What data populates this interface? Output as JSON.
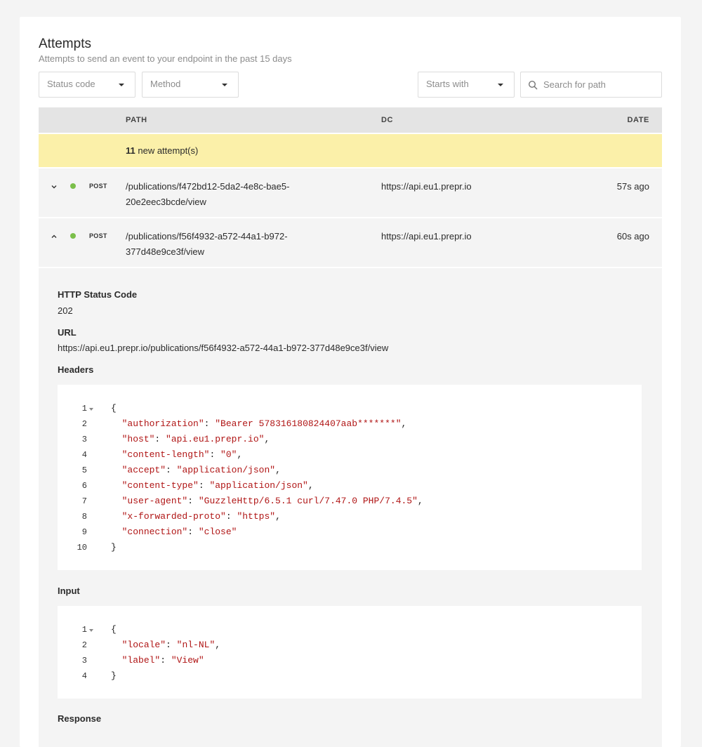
{
  "header": {
    "title": "Attempts",
    "subtitle": "Attempts to send an event to your endpoint in the past 15 days"
  },
  "filters": {
    "status_code": "Status code",
    "method": "Method",
    "match_mode": "Starts with",
    "search_placeholder": "Search for path"
  },
  "table": {
    "columns": {
      "path": "PATH",
      "dc": "DC",
      "date": "DATE"
    },
    "banner": {
      "count": "11",
      "text": " new attempt(s)"
    },
    "rows": [
      {
        "method": "POST",
        "path": "/publications/f472bd12-5da2-4e8c-bae5-20e2eec3bcde/view",
        "dc": "https://api.eu1.prepr.io",
        "date": "57s ago",
        "expanded": false
      },
      {
        "method": "POST",
        "path": "/publications/f56f4932-a572-44a1-b972-377d48e9ce3f/view",
        "dc": "https://api.eu1.prepr.io",
        "date": "60s ago",
        "expanded": true
      }
    ]
  },
  "detail": {
    "status_label": "HTTP Status Code",
    "status_value": "202",
    "url_label": "URL",
    "url_value": "https://api.eu1.prepr.io/publications/f56f4932-a572-44a1-b972-377d48e9ce3f/view",
    "headers_label": "Headers",
    "headers_lines": [
      {
        "n": "1",
        "key": "",
        "val": "",
        "text": "{"
      },
      {
        "n": "2",
        "key": "\"authorization\"",
        "val": "\"Bearer 578316180824407aab*******\"",
        "comma": ","
      },
      {
        "n": "3",
        "key": "\"host\"",
        "val": "\"api.eu1.prepr.io\"",
        "comma": ","
      },
      {
        "n": "4",
        "key": "\"content-length\"",
        "val": "\"0\"",
        "comma": ","
      },
      {
        "n": "5",
        "key": "\"accept\"",
        "val": "\"application/json\"",
        "comma": ","
      },
      {
        "n": "6",
        "key": "\"content-type\"",
        "val": "\"application/json\"",
        "comma": ","
      },
      {
        "n": "7",
        "key": "\"user-agent\"",
        "val": "\"GuzzleHttp/6.5.1 curl/7.47.0 PHP/7.4.5\"",
        "comma": ","
      },
      {
        "n": "8",
        "key": "\"x-forwarded-proto\"",
        "val": "\"https\"",
        "comma": ","
      },
      {
        "n": "9",
        "key": "\"connection\"",
        "val": "\"close\"",
        "comma": ""
      },
      {
        "n": "10",
        "key": "",
        "val": "",
        "text": "}"
      }
    ],
    "input_label": "Input",
    "input_lines": [
      {
        "n": "1",
        "key": "",
        "val": "",
        "text": "{"
      },
      {
        "n": "2",
        "key": "\"locale\"",
        "val": "\"nl-NL\"",
        "comma": ","
      },
      {
        "n": "3",
        "key": "\"label\"",
        "val": "\"View\"",
        "comma": ""
      },
      {
        "n": "4",
        "key": "",
        "val": "",
        "text": "}"
      }
    ],
    "response_label": "Response"
  },
  "colors": {
    "status_dot": "#7bbf4a",
    "banner": "#fbf0a9",
    "string": "#b01515"
  }
}
